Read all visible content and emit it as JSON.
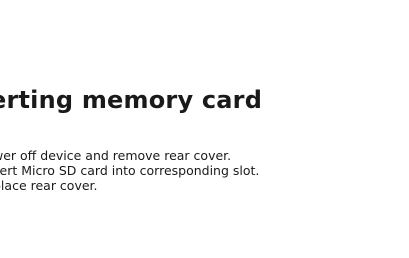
{
  "section": {
    "title": "erting memory card",
    "steps": [
      "wer off device and remove rear cover.",
      "sert Micro SD card into corresponding slot.",
      "place rear cover."
    ]
  }
}
